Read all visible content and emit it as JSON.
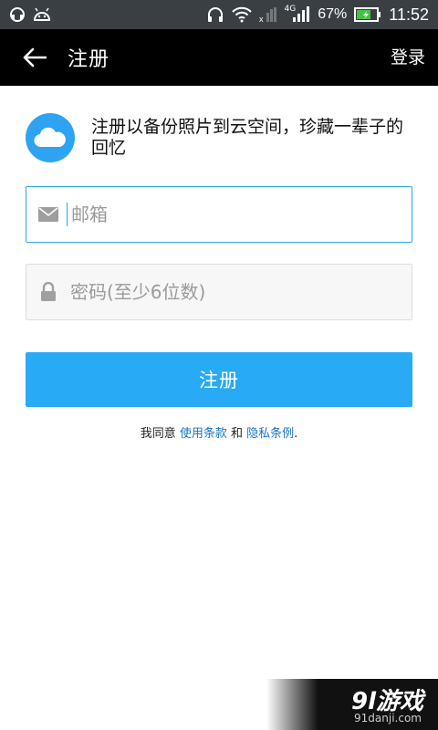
{
  "statusbar": {
    "icons": [
      "headset-icon",
      "android-icon",
      "headphones-icon",
      "wifi-icon",
      "no-sim-icon",
      "signal-icon",
      "battery-icon"
    ],
    "network": "4G",
    "battery": "67%",
    "time": "11:52"
  },
  "appbar": {
    "title": "注册",
    "login": "登录"
  },
  "intro": {
    "text": "注册以备份照片到云空间，珍藏一辈子的回忆"
  },
  "form": {
    "email_placeholder": "邮箱",
    "password_placeholder": "密码(至少6位数)",
    "submit": "注册"
  },
  "agreement": {
    "prefix": "我同意 ",
    "terms": "使用条款",
    "and": " 和 ",
    "privacy": "隐私条例",
    "suffix": "."
  },
  "watermark": {
    "logo": "9l游戏",
    "url": "91danji.com"
  },
  "colors": {
    "accent": "#2ea3f2",
    "button": "#29aaf5",
    "appbar": "#000000",
    "statusbar": "#3a3f44",
    "link": "#1a73c8"
  }
}
